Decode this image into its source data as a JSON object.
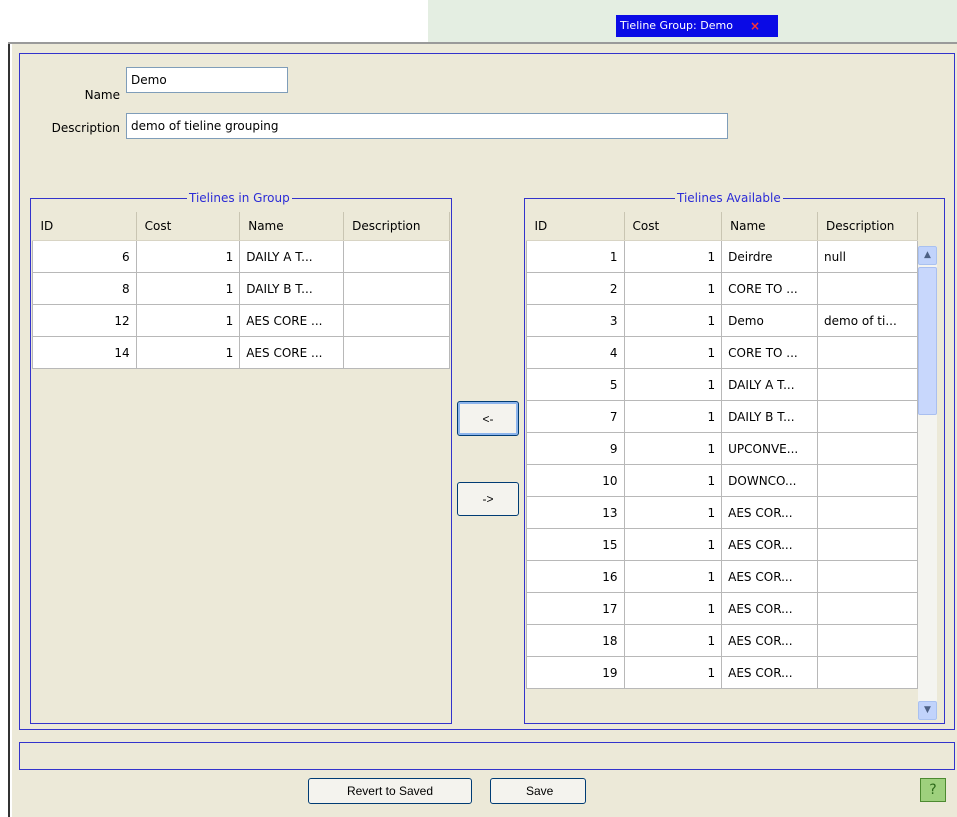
{
  "tab": {
    "title": "Tieline Group: Demo",
    "close_glyph": "×"
  },
  "form": {
    "name_label": "Name",
    "name_value": "Demo",
    "description_label": "Description",
    "description_value": "demo of tieline grouping"
  },
  "in_group": {
    "title": "Tielines in Group",
    "columns": [
      "ID",
      "Cost",
      "Name",
      "Description"
    ],
    "rows": [
      [
        "6",
        "1",
        "DAILY A T...",
        ""
      ],
      [
        "8",
        "1",
        "DAILY B T...",
        ""
      ],
      [
        "12",
        "1",
        "AES CORE ...",
        ""
      ],
      [
        "14",
        "1",
        "AES CORE ...",
        ""
      ]
    ]
  },
  "available": {
    "title": "Tielines Available",
    "columns": [
      "ID",
      "Cost",
      "Name",
      "Description"
    ],
    "rows": [
      [
        "1",
        "1",
        "Deirdre",
        "null"
      ],
      [
        "2",
        "1",
        "CORE TO ...",
        ""
      ],
      [
        "3",
        "1",
        "Demo",
        "demo of ti..."
      ],
      [
        "4",
        "1",
        "CORE TO ...",
        ""
      ],
      [
        "5",
        "1",
        "DAILY A T...",
        ""
      ],
      [
        "7",
        "1",
        "DAILY B T...",
        ""
      ],
      [
        "9",
        "1",
        "UPCONVE...",
        ""
      ],
      [
        "10",
        "1",
        "DOWNCO...",
        ""
      ],
      [
        "13",
        "1",
        "AES COR...",
        ""
      ],
      [
        "15",
        "1",
        "AES COR...",
        ""
      ],
      [
        "16",
        "1",
        "AES COR...",
        ""
      ],
      [
        "17",
        "1",
        "AES COR...",
        ""
      ],
      [
        "18",
        "1",
        "AES COR...",
        ""
      ],
      [
        "19",
        "1",
        "AES COR...",
        ""
      ]
    ]
  },
  "buttons": {
    "add_label": "<-",
    "remove_label": "->",
    "revert_label": "Revert to Saved",
    "save_label": "Save",
    "help_glyph": "?"
  },
  "colors": {
    "tab_bg": "#0a0ae6",
    "group_border": "#3333cc",
    "panel_bg": "#ece9d8"
  },
  "icons": {
    "close": "close-icon",
    "help": "help-icon",
    "scroll_up": "scroll-up-arrow-icon",
    "scroll_down": "scroll-down-arrow-icon"
  }
}
